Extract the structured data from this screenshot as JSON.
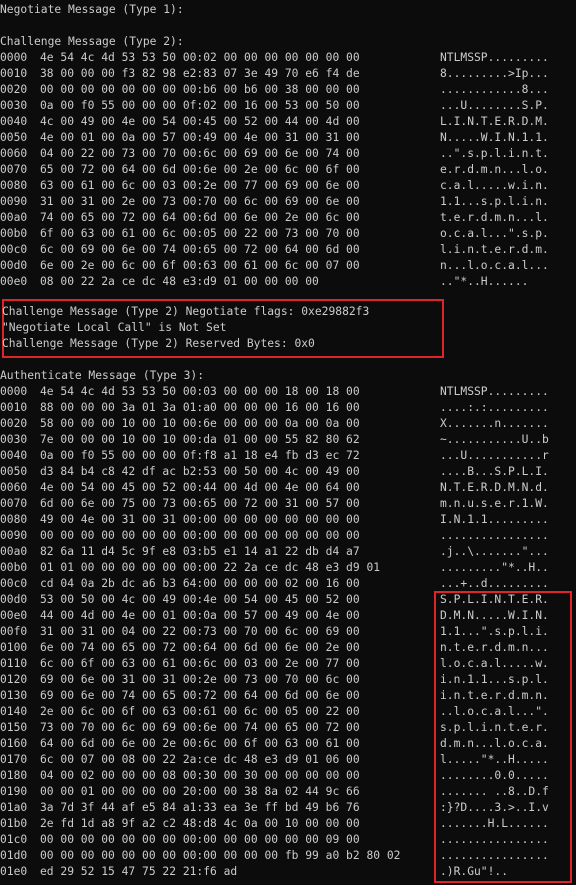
{
  "negotiate_title": "Negotiate Message (Type 1):",
  "challenge_title": "Challenge Message (Type 2):",
  "challenge_rows": [
    {
      "offset": "0000",
      "hex": "4e 54 4c 4d 53 53 50 00:02 00 00 00 00 00 00 00",
      "ascii": "NTLMSSP........."
    },
    {
      "offset": "0010",
      "hex": "38 00 00 00 f3 82 98 e2:83 07 3e 49 70 e6 f4 de",
      "ascii": "8.........>Ip..."
    },
    {
      "offset": "0020",
      "hex": "00 00 00 00 00 00 00 00:b6 00 b6 00 38 00 00 00",
      "ascii": "............8..."
    },
    {
      "offset": "0030",
      "hex": "0a 00 f0 55 00 00 00 0f:02 00 16 00 53 00 50 00",
      "ascii": "...U........S.P."
    },
    {
      "offset": "0040",
      "hex": "4c 00 49 00 4e 00 54 00:45 00 52 00 44 00 4d 00",
      "ascii": "L.I.N.T.E.R.D.M."
    },
    {
      "offset": "0050",
      "hex": "4e 00 01 00 0a 00 57 00:49 00 4e 00 31 00 31 00",
      "ascii": "N.....W.I.N.1.1."
    },
    {
      "offset": "0060",
      "hex": "04 00 22 00 73 00 70 00:6c 00 69 00 6e 00 74 00",
      "ascii": "..\".s.p.l.i.n.t."
    },
    {
      "offset": "0070",
      "hex": "65 00 72 00 64 00 6d 00:6e 00 2e 00 6c 00 6f 00",
      "ascii": "e.r.d.m.n...l.o."
    },
    {
      "offset": "0080",
      "hex": "63 00 61 00 6c 00 03 00:2e 00 77 00 69 00 6e 00",
      "ascii": "c.a.l.....w.i.n."
    },
    {
      "offset": "0090",
      "hex": "31 00 31 00 2e 00 73 00:70 00 6c 00 69 00 6e 00",
      "ascii": "1.1...s.p.l.i.n."
    },
    {
      "offset": "00a0",
      "hex": "74 00 65 00 72 00 64 00:6d 00 6e 00 2e 00 6c 00",
      "ascii": "t.e.r.d.m.n...l."
    },
    {
      "offset": "00b0",
      "hex": "6f 00 63 00 61 00 6c 00:05 00 22 00 73 00 70 00",
      "ascii": "o.c.a.l...\".s.p."
    },
    {
      "offset": "00c0",
      "hex": "6c 00 69 00 6e 00 74 00:65 00 72 00 64 00 6d 00",
      "ascii": "l.i.n.t.e.r.d.m."
    },
    {
      "offset": "00d0",
      "hex": "6e 00 2e 00 6c 00 6f 00:63 00 61 00 6c 00 07 00",
      "ascii": "n...l.o.c.a.l..."
    },
    {
      "offset": "00e0",
      "hex": "08 00 22 2a ce dc 48 e3:d9 01 00 00 00 00",
      "ascii": "..\"*..H......"
    }
  ],
  "flags_lines": [
    "Challenge Message (Type 2) Negotiate flags: 0xe29882f3",
    "\"Negotiate Local Call\" is Not Set",
    "Challenge Message (Type 2) Reserved Bytes: 0x0"
  ],
  "authenticate_title": "Authenticate Message (Type 3):",
  "authenticate_rows": [
    {
      "offset": "0000",
      "hex": "4e 54 4c 4d 53 53 50 00:03 00 00 00 18 00 18 00",
      "ascii": "NTLMSSP........."
    },
    {
      "offset": "0010",
      "hex": "88 00 00 00 3a 01 3a 01:a0 00 00 00 16 00 16 00",
      "ascii": "....:.:........."
    },
    {
      "offset": "0020",
      "hex": "58 00 00 00 10 00 10 00:6e 00 00 00 0a 00 0a 00",
      "ascii": "X.......n......."
    },
    {
      "offset": "0030",
      "hex": "7e 00 00 00 10 00 10 00:da 01 00 00 55 82 80 62",
      "ascii": "~...........U..b"
    },
    {
      "offset": "0040",
      "hex": "0a 00 f0 55 00 00 00 0f:f8 a1 18 e4 fb d3 ec 72",
      "ascii": "...U...........r"
    },
    {
      "offset": "0050",
      "hex": "d3 84 b4 c8 42 df ac b2:53 00 50 00 4c 00 49 00",
      "ascii": "....B...S.P.L.I."
    },
    {
      "offset": "0060",
      "hex": "4e 00 54 00 45 00 52 00:44 00 4d 00 4e 00 64 00",
      "ascii": "N.T.E.R.D.M.N.d."
    },
    {
      "offset": "0070",
      "hex": "6d 00 6e 00 75 00 73 00:65 00 72 00 31 00 57 00",
      "ascii": "m.n.u.s.e.r.1.W."
    },
    {
      "offset": "0080",
      "hex": "49 00 4e 00 31 00 31 00:00 00 00 00 00 00 00 00",
      "ascii": "I.N.1.1........."
    },
    {
      "offset": "0090",
      "hex": "00 00 00 00 00 00 00 00:00 00 00 00 00 00 00 00",
      "ascii": "................"
    },
    {
      "offset": "00a0",
      "hex": "82 6a 11 d4 5c 9f e8 03:b5 e1 14 a1 22 db d4 a7",
      "ascii": ".j..\\.......\"..."
    },
    {
      "offset": "00b0",
      "hex": "01 01 00 00 00 00 00 00:00 22 2a ce dc 48 e3 d9 01",
      "ascii": ".........\"*..H.."
    },
    {
      "offset": "00c0",
      "hex": "cd 04 0a 2b dc a6 b3 64:00 00 00 00 02 00 16 00",
      "ascii": "...+..d........."
    },
    {
      "offset": "00d0",
      "hex": "53 00 50 00 4c 00 49 00:4e 00 54 00 45 00 52 00",
      "ascii": "S.P.L.I.N.T.E.R."
    },
    {
      "offset": "00e0",
      "hex": "44 00 4d 00 4e 00 01 00:0a 00 57 00 49 00 4e 00",
      "ascii": "D.M.N.....W.I.N."
    },
    {
      "offset": "00f0",
      "hex": "31 00 31 00 04 00 22 00:73 00 70 00 6c 00 69 00",
      "ascii": "1.1...\".s.p.l.i."
    },
    {
      "offset": "0100",
      "hex": "6e 00 74 00 65 00 72 00:64 00 6d 00 6e 00 2e 00",
      "ascii": "n.t.e.r.d.m.n..."
    },
    {
      "offset": "0110",
      "hex": "6c 00 6f 00 63 00 61 00:6c 00 03 00 2e 00 77 00",
      "ascii": "l.o.c.a.l.....w."
    },
    {
      "offset": "0120",
      "hex": "69 00 6e 00 31 00 31 00:2e 00 73 00 70 00 6c 00",
      "ascii": "i.n.1.1...s.p.l."
    },
    {
      "offset": "0130",
      "hex": "69 00 6e 00 74 00 65 00:72 00 64 00 6d 00 6e 00",
      "ascii": "i.n.t.e.r.d.m.n."
    },
    {
      "offset": "0140",
      "hex": "2e 00 6c 00 6f 00 63 00:61 00 6c 00 05 00 22 00",
      "ascii": "..l.o.c.a.l...\"."
    },
    {
      "offset": "0150",
      "hex": "73 00 70 00 6c 00 69 00:6e 00 74 00 65 00 72 00",
      "ascii": "s.p.l.i.n.t.e.r."
    },
    {
      "offset": "0160",
      "hex": "64 00 6d 00 6e 00 2e 00:6c 00 6f 00 63 00 61 00",
      "ascii": "d.m.n...l.o.c.a."
    },
    {
      "offset": "0170",
      "hex": "6c 00 07 00 08 00 22 2a:ce dc 48 e3 d9 01 06 00",
      "ascii": "l.....\"*..H....."
    },
    {
      "offset": "0180",
      "hex": "04 00 02 00 00 00 08 00:30 00 30 00 00 00 00 00",
      "ascii": "........0.0....."
    },
    {
      "offset": "0190",
      "hex": "00 00 01 00 00 00 00 20:00 00 38 8a 02 44 9c 66",
      "ascii": "....... ..8..D.f"
    },
    {
      "offset": "01a0",
      "hex": "3a 7d 3f 44 af e5 84 a1:33 ea 3e ff bd 49 b6 76",
      "ascii": ":}?D....3.>..I.v"
    },
    {
      "offset": "01b0",
      "hex": "2e fd 1d a8 9f a2 c2 48:d8 4c 0a 00 10 00 00 00",
      "ascii": ".......H.L......"
    },
    {
      "offset": "01c0",
      "hex": "00 00 00 00 00 00 00 00:00 00 00 00 00 00 09 00",
      "ascii": "................"
    },
    {
      "offset": "01d0",
      "hex": "00 00 00 00 00 00 00 00:00 00 00 00 fb 99 a0 b2 80 02",
      "ascii": "................"
    },
    {
      "offset": "01e0",
      "hex": "ed 29 52 15 47 75 22 21:f6 ad",
      "ascii": ".)R.Gu\"!.."
    }
  ],
  "colors": {
    "background": "#0c0c0c",
    "text": "#cccccc",
    "highlight": "#e0242b"
  }
}
